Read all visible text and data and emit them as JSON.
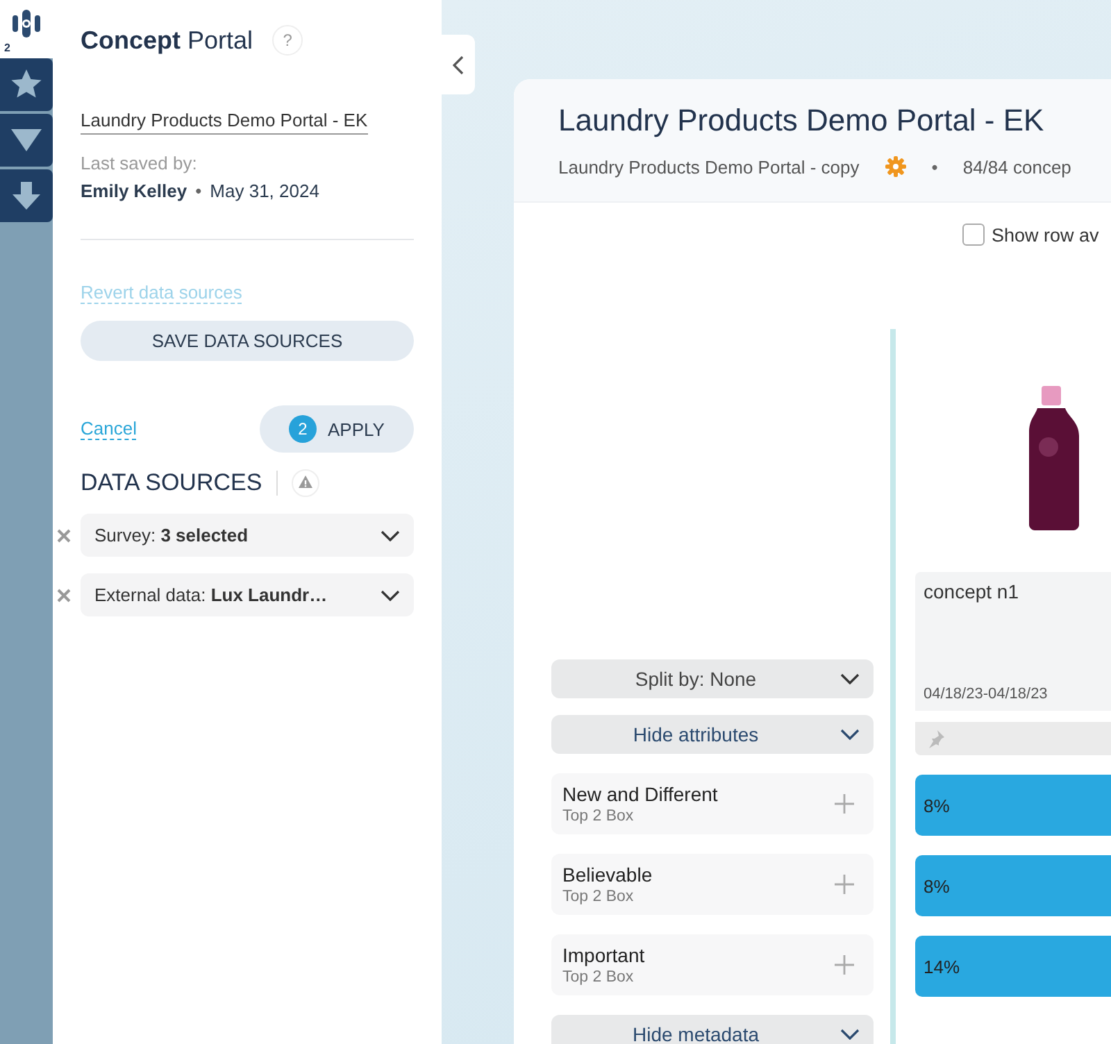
{
  "rail": {
    "badge": "2"
  },
  "sidebar": {
    "title": "**Concept** Portal",
    "help": "?",
    "portal_name": "Laundry Products Demo Portal - EK",
    "last_saved_label": "Last saved by:",
    "saved_by": "Emily Kelley",
    "saved_sep": "•",
    "saved_date": "May 31, 2024",
    "revert_link": "Revert data sources",
    "save_button": "SAVE DATA SOURCES",
    "cancel_link": "Cancel",
    "apply": {
      "count": "2",
      "label": "APPLY"
    },
    "sources_heading": "DATA SOURCES",
    "sources": [
      {
        "label": "Survey:",
        "value": "3 selected"
      },
      {
        "label": "External data:",
        "value": "Lux Laundr…"
      }
    ]
  },
  "main": {
    "title": "Laundry Products Demo Portal - EK",
    "subtitle": "Laundry Products Demo Portal - copy",
    "sub_sep": "•",
    "count": "84/84 concep",
    "show_row": {
      "label": "Show row av",
      "checked": false
    },
    "split_by": "Split by: None",
    "hide_attributes": "Hide attributes",
    "attributes": [
      {
        "name": "New and Different",
        "sub": "Top 2 Box"
      },
      {
        "name": "Believable",
        "sub": "Top 2 Box"
      },
      {
        "name": "Important",
        "sub": "Top 2 Box"
      }
    ],
    "hide_metadata": "Hide metadata",
    "concept": {
      "name": "concept n1",
      "dates": "04/18/23-04/18/23",
      "values": [
        "8%",
        "8%",
        "14%"
      ]
    }
  }
}
